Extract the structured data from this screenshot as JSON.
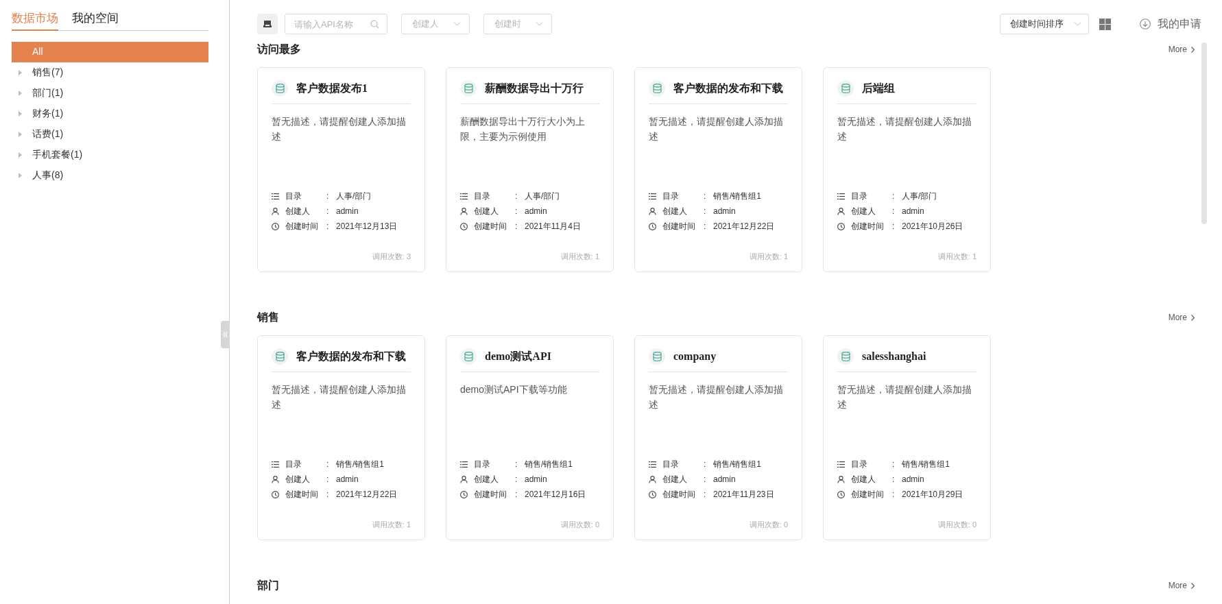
{
  "sidebar": {
    "tabs": [
      {
        "label": "数据市场",
        "selected": true
      },
      {
        "label": "我的空间",
        "selected": false
      }
    ],
    "items": [
      {
        "label": "All",
        "selected": true,
        "expandable": false
      },
      {
        "label": "销售(7)",
        "selected": false,
        "expandable": true
      },
      {
        "label": "部门(1)",
        "selected": false,
        "expandable": true
      },
      {
        "label": "财务(1)",
        "selected": false,
        "expandable": true
      },
      {
        "label": "话费(1)",
        "selected": false,
        "expandable": true
      },
      {
        "label": "手机套餐(1)",
        "selected": false,
        "expandable": true
      },
      {
        "label": "人事(8)",
        "selected": false,
        "expandable": true
      }
    ]
  },
  "toolbar": {
    "search": {
      "placeholder": "请输入API名称"
    },
    "filters": [
      {
        "placeholder": "创建人"
      },
      {
        "placeholder": "创建时"
      }
    ],
    "sort": {
      "value": "创建时间排序"
    },
    "my_requests": "我的申请"
  },
  "sections": [
    {
      "title": "访问最多",
      "more": "More",
      "cards": [
        {
          "title": "客户数据发布1",
          "description": "暂无描述，请提醒创建人添加描述",
          "meta": [
            {
              "kind": "catalog",
              "label": "目录",
              "sep": ":",
              "value": "人事/部门"
            },
            {
              "kind": "creator",
              "label": "创建人",
              "sep": ":",
              "value": "admin"
            },
            {
              "kind": "time",
              "label": "创建时间",
              "sep": ":",
              "value": "2021年12月13日"
            }
          ],
          "calls": "调用次数: 3"
        },
        {
          "title": "薪酬数据导出十万行",
          "description": "薪酬数据导出十万行大小为上限，主要为示例使用",
          "meta": [
            {
              "kind": "catalog",
              "label": "目录",
              "sep": ":",
              "value": "人事/部门"
            },
            {
              "kind": "creator",
              "label": "创建人",
              "sep": ":",
              "value": "admin"
            },
            {
              "kind": "time",
              "label": "创建时间",
              "sep": ":",
              "value": "2021年11月4日"
            }
          ],
          "calls": "调用次数: 1"
        },
        {
          "title": "客户数据的发布和下载",
          "description": "暂无描述，请提醒创建人添加描述",
          "meta": [
            {
              "kind": "catalog",
              "label": "目录",
              "sep": ":",
              "value": "销售/销售组1"
            },
            {
              "kind": "creator",
              "label": "创建人",
              "sep": ":",
              "value": "admin"
            },
            {
              "kind": "time",
              "label": "创建时间",
              "sep": ":",
              "value": "2021年12月22日"
            }
          ],
          "calls": "调用次数: 1"
        },
        {
          "title": "后端组",
          "description": "暂无描述，请提醒创建人添加描述",
          "meta": [
            {
              "kind": "catalog",
              "label": "目录",
              "sep": ":",
              "value": "人事/部门"
            },
            {
              "kind": "creator",
              "label": "创建人",
              "sep": ":",
              "value": "admin"
            },
            {
              "kind": "time",
              "label": "创建时间",
              "sep": ":",
              "value": "2021年10月26日"
            }
          ],
          "calls": "调用次数: 1"
        }
      ]
    },
    {
      "title": "销售",
      "more": "More",
      "cards": [
        {
          "title": "客户数据的发布和下载",
          "description": "暂无描述，请提醒创建人添加描述",
          "meta": [
            {
              "kind": "catalog",
              "label": "目录",
              "sep": ":",
              "value": "销售/销售组1"
            },
            {
              "kind": "creator",
              "label": "创建人",
              "sep": ":",
              "value": "admin"
            },
            {
              "kind": "time",
              "label": "创建时间",
              "sep": ":",
              "value": "2021年12月22日"
            }
          ],
          "calls": "调用次数: 1"
        },
        {
          "title": "demo测试API",
          "description": "demo测试API下载等功能",
          "meta": [
            {
              "kind": "catalog",
              "label": "目录",
              "sep": ":",
              "value": "销售/销售组1"
            },
            {
              "kind": "creator",
              "label": "创建人",
              "sep": ":",
              "value": "admin"
            },
            {
              "kind": "time",
              "label": "创建时间",
              "sep": ":",
              "value": "2021年12月16日"
            }
          ],
          "calls": "调用次数: 0"
        },
        {
          "title": "company",
          "description": "暂无描述，请提醒创建人添加描述",
          "meta": [
            {
              "kind": "catalog",
              "label": "目录",
              "sep": ":",
              "value": "销售/销售组1"
            },
            {
              "kind": "creator",
              "label": "创建人",
              "sep": ":",
              "value": "admin"
            },
            {
              "kind": "time",
              "label": "创建时间",
              "sep": ":",
              "value": "2021年11月23日"
            }
          ],
          "calls": "调用次数: 0"
        },
        {
          "title": "salesshanghai",
          "description": "暂无描述，请提醒创建人添加描述",
          "meta": [
            {
              "kind": "catalog",
              "label": "目录",
              "sep": ":",
              "value": "销售/销售组1"
            },
            {
              "kind": "creator",
              "label": "创建人",
              "sep": ":",
              "value": "admin"
            },
            {
              "kind": "time",
              "label": "创建时间",
              "sep": ":",
              "value": "2021年10月29日"
            }
          ],
          "calls": "调用次数: 0"
        }
      ]
    },
    {
      "title": "部门",
      "more": "More"
    }
  ]
}
